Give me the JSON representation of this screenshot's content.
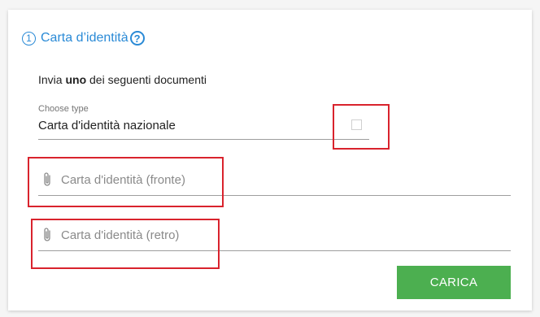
{
  "header": {
    "step_number": "1",
    "title": "Carta d’identità",
    "help_icon": "question-circle-icon",
    "accent_color": "#2a8ad6"
  },
  "instruction": {
    "prefix": "Invia ",
    "bold": "uno",
    "suffix": " dei seguenti documenti"
  },
  "document_select": {
    "label": "Choose type",
    "value": "Carta d'identità nazionale"
  },
  "uploads": [
    {
      "label": "Carta d'identità (fronte)",
      "icon": "paperclip-icon"
    },
    {
      "label": "Carta d'identità (retro)",
      "icon": "paperclip-icon"
    }
  ],
  "actions": {
    "upload_label": "CARICA",
    "upload_color": "#4caf50"
  },
  "highlight_color": "#d9232d"
}
